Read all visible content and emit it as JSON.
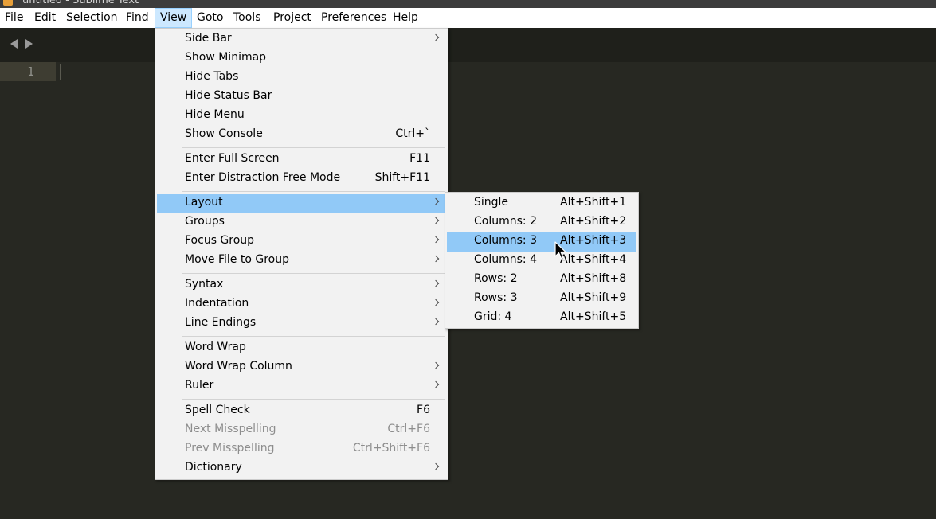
{
  "window": {
    "title": "untitled - Sublime Text"
  },
  "menubar": {
    "items": [
      {
        "label": "File"
      },
      {
        "label": "Edit"
      },
      {
        "label": "Selection"
      },
      {
        "label": "Find"
      },
      {
        "label": "View",
        "active": true
      },
      {
        "label": "Goto"
      },
      {
        "label": "Tools"
      },
      {
        "label": "Project"
      },
      {
        "label": "Preferences"
      },
      {
        "label": "Help"
      }
    ]
  },
  "editor": {
    "line_number": "1"
  },
  "view_menu": {
    "items": [
      {
        "label": "Side Bar",
        "shortcut": "",
        "submenu": true
      },
      {
        "label": "Show Minimap",
        "shortcut": ""
      },
      {
        "label": "Hide Tabs",
        "shortcut": ""
      },
      {
        "label": "Hide Status Bar",
        "shortcut": ""
      },
      {
        "label": "Hide Menu",
        "shortcut": ""
      },
      {
        "label": "Show Console",
        "shortcut": "Ctrl+`"
      },
      {
        "label": "Enter Full Screen",
        "shortcut": "F11"
      },
      {
        "label": "Enter Distraction Free Mode",
        "shortcut": "Shift+F11"
      },
      {
        "label": "Layout",
        "shortcut": "",
        "submenu": true,
        "highlighted": true
      },
      {
        "label": "Groups",
        "shortcut": "",
        "submenu": true
      },
      {
        "label": "Focus Group",
        "shortcut": "",
        "submenu": true
      },
      {
        "label": "Move File to Group",
        "shortcut": "",
        "submenu": true
      },
      {
        "label": "Syntax",
        "shortcut": "",
        "submenu": true
      },
      {
        "label": "Indentation",
        "shortcut": "",
        "submenu": true
      },
      {
        "label": "Line Endings",
        "shortcut": "",
        "submenu": true
      },
      {
        "label": "Word Wrap",
        "shortcut": ""
      },
      {
        "label": "Word Wrap Column",
        "shortcut": "",
        "submenu": true
      },
      {
        "label": "Ruler",
        "shortcut": "",
        "submenu": true
      },
      {
        "label": "Spell Check",
        "shortcut": "F6"
      },
      {
        "label": "Next Misspelling",
        "shortcut": "Ctrl+F6",
        "disabled": true
      },
      {
        "label": "Prev Misspelling",
        "shortcut": "Ctrl+Shift+F6",
        "disabled": true
      },
      {
        "label": "Dictionary",
        "shortcut": "",
        "submenu": true
      }
    ]
  },
  "layout_menu": {
    "items": [
      {
        "label": "Single",
        "shortcut": "Alt+Shift+1"
      },
      {
        "label": "Columns: 2",
        "shortcut": "Alt+Shift+2"
      },
      {
        "label": "Columns: 3",
        "shortcut": "Alt+Shift+3",
        "highlighted": true
      },
      {
        "label": "Columns: 4",
        "shortcut": "Alt+Shift+4"
      },
      {
        "label": "Rows: 2",
        "shortcut": "Alt+Shift+8"
      },
      {
        "label": "Rows: 3",
        "shortcut": "Alt+Shift+9"
      },
      {
        "label": "Grid: 4",
        "shortcut": "Alt+Shift+5"
      }
    ]
  },
  "colors": {
    "editor_bg": "#272822",
    "menu_bg": "#f2f2f2",
    "highlight": "#91c9f7",
    "menubar_active": "#cce8ff",
    "disabled_text": "#8d8d8d"
  }
}
